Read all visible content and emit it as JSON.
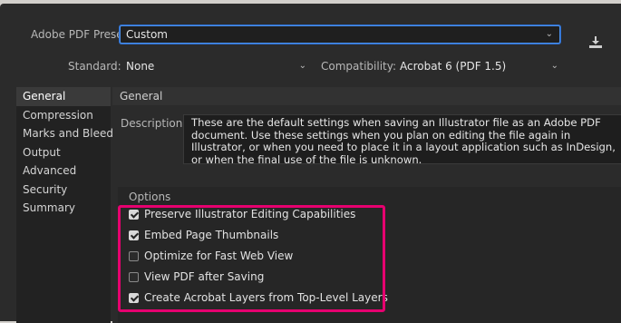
{
  "preset": {
    "label": "Adobe PDF Preset:",
    "value": "Custom"
  },
  "standard": {
    "label": "Standard:",
    "value": "None"
  },
  "compatibility": {
    "label": "Compatibility:",
    "value": "Acrobat 6 (PDF 1.5)"
  },
  "icons": {
    "save_preset": "save-preset-icon",
    "chevron": "chevron-down-icon",
    "checkbox_checked": "checkmark-icon"
  },
  "sidebar": {
    "items": [
      {
        "label": "General",
        "active": true
      },
      {
        "label": "Compression"
      },
      {
        "label": "Marks and Bleeds"
      },
      {
        "label": "Output"
      },
      {
        "label": "Advanced"
      },
      {
        "label": "Security"
      },
      {
        "label": "Summary"
      }
    ]
  },
  "main": {
    "section_title": "General",
    "description_label": "Description:",
    "description": "These are the default settings when saving an Illustrator file as an Adobe PDF document. Use these settings when you plan on editing the file again in Illustrator, or when you need to place it in a layout application such as InDesign, or when the final use of the file is unknown.",
    "options_title": "Options",
    "options": [
      {
        "label": "Preserve Illustrator Editing Capabilities",
        "checked": true
      },
      {
        "label": "Embed Page Thumbnails",
        "checked": true
      },
      {
        "label": "Optimize for Fast Web View",
        "checked": false
      },
      {
        "label": "View PDF after Saving",
        "checked": false
      },
      {
        "label": "Create Acrobat Layers from Top-Level Layers",
        "checked": true
      }
    ]
  },
  "colors": {
    "highlight": "#e6006f",
    "focus": "#4a8fe8",
    "background": "#2b2b2b"
  }
}
